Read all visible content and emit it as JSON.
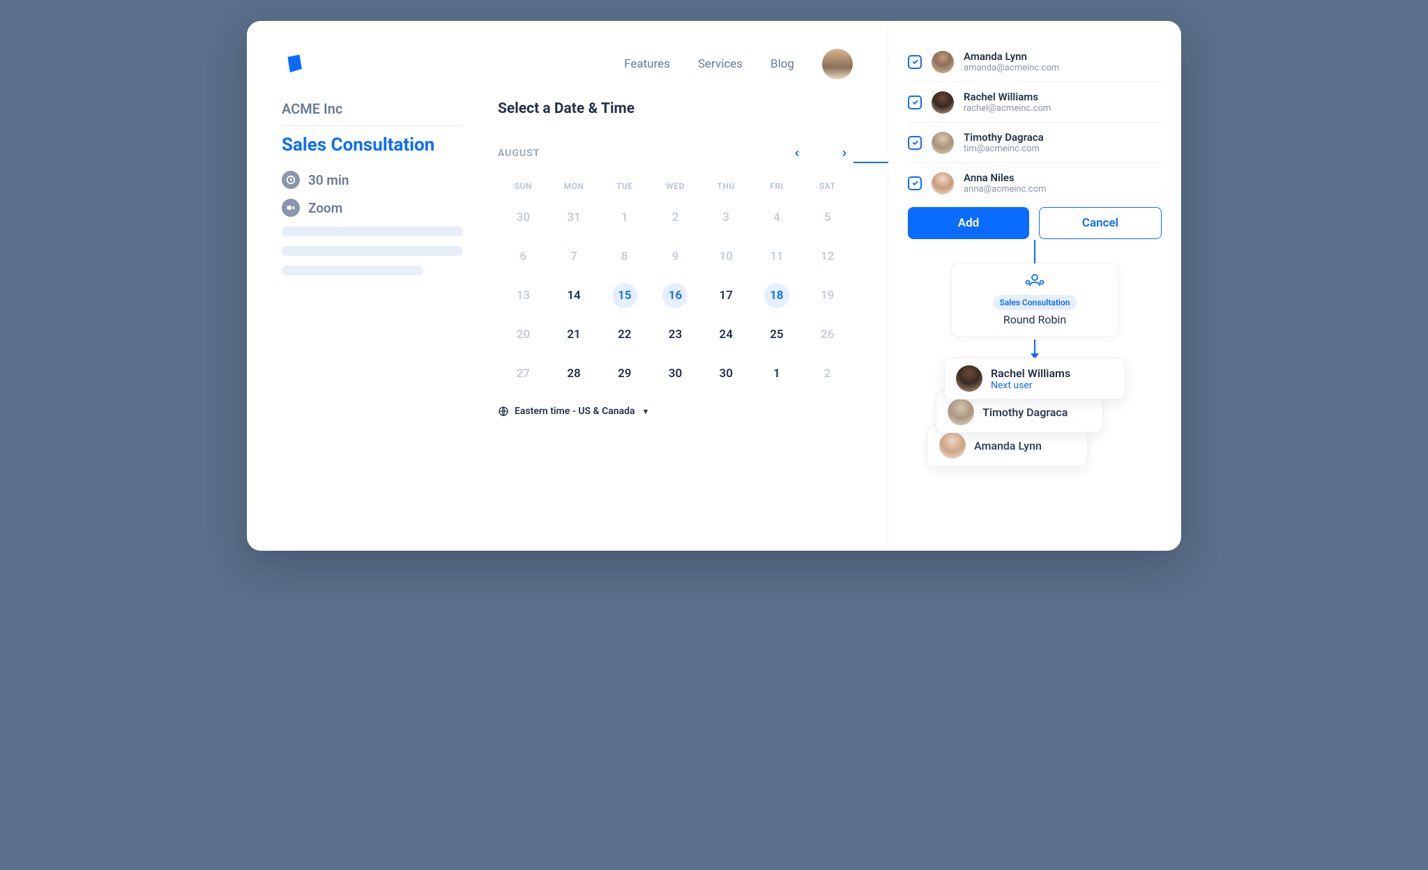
{
  "header": {
    "nav": [
      "Features",
      "Services",
      "Blog"
    ]
  },
  "sidebar": {
    "company": "ACME Inc",
    "title": "Sales Consultation",
    "duration": "30 min",
    "platform": "Zoom"
  },
  "calendar": {
    "heading": "Select a Date & Time",
    "month": "AUGUST",
    "dayHeads": [
      "SUN",
      "MON",
      "TUE",
      "WED",
      "THU",
      "FRI",
      "SAT"
    ],
    "weeks": [
      [
        {
          "n": "30",
          "m": true
        },
        {
          "n": "31",
          "m": true
        },
        {
          "n": "1",
          "m": true
        },
        {
          "n": "2",
          "m": true
        },
        {
          "n": "3",
          "m": true
        },
        {
          "n": "4",
          "m": true
        },
        {
          "n": "5",
          "m": true
        }
      ],
      [
        {
          "n": "6",
          "m": true
        },
        {
          "n": "7",
          "m": true
        },
        {
          "n": "8",
          "m": true
        },
        {
          "n": "9",
          "m": true
        },
        {
          "n": "10",
          "m": true
        },
        {
          "n": "11",
          "m": true
        },
        {
          "n": "12",
          "m": true
        }
      ],
      [
        {
          "n": "13",
          "m": true
        },
        {
          "n": "14"
        },
        {
          "n": "15",
          "a": true
        },
        {
          "n": "16",
          "a": true
        },
        {
          "n": "17"
        },
        {
          "n": "18",
          "a": true
        },
        {
          "n": "19",
          "m": true
        }
      ],
      [
        {
          "n": "20",
          "m": true
        },
        {
          "n": "21"
        },
        {
          "n": "22"
        },
        {
          "n": "23"
        },
        {
          "n": "24"
        },
        {
          "n": "25"
        },
        {
          "n": "26",
          "m": true
        }
      ],
      [
        {
          "n": "27",
          "m": true
        },
        {
          "n": "28"
        },
        {
          "n": "29"
        },
        {
          "n": "30"
        },
        {
          "n": "30"
        },
        {
          "n": "1"
        },
        {
          "n": "2",
          "m": true
        }
      ]
    ],
    "timezone": "Eastern time - US & Canada"
  },
  "people": [
    {
      "name": "Amanda Lynn",
      "email": "amanda@acmeinc.com",
      "av": "av-a"
    },
    {
      "name": "Rachel Williams",
      "email": "rachel@acmeinc.com",
      "av": "av-b"
    },
    {
      "name": "Timothy Dagraca",
      "email": "tim@acmeinc.com",
      "av": "av-c"
    },
    {
      "name": "Anna Niles",
      "email": "anna@acmeinc.com",
      "av": "av-d"
    }
  ],
  "buttons": {
    "add": "Add",
    "cancel": "Cancel"
  },
  "flow": {
    "pill": "Sales Consultation",
    "label": "Round Robin",
    "queue": [
      {
        "name": "Rachel Williams",
        "sub": "Next user",
        "av": "av-b"
      },
      {
        "name": "Timothy Dagraca",
        "av": "av-c"
      },
      {
        "name": "Amanda Lynn",
        "av": "av-d"
      }
    ]
  }
}
